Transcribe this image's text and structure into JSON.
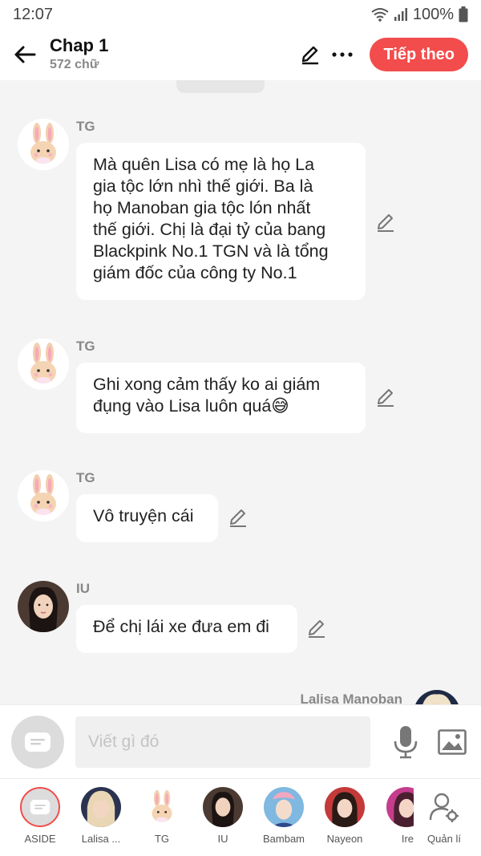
{
  "status": {
    "time": "12:07",
    "battery": "100%"
  },
  "header": {
    "title": "Chap 1",
    "subtitle": "572 chữ",
    "next_label": "Tiếp theo"
  },
  "messages": [
    {
      "sender": "TG",
      "lines": [
        "Mà quên Lisa có mẹ là họ La",
        "gia tộc lớn nhì thế giới. Ba là",
        "họ Manoban gia tộc lón nhất",
        "thế giới. Chị là đại tỷ của bang",
        "Blackpink No.1 TGN và là tổng",
        "giám đốc của công ty No.1"
      ]
    },
    {
      "sender": "TG",
      "lines": [
        "Ghi xong cảm thấy ko ai giám",
        "đụng vào Lisa luôn quá😅"
      ]
    },
    {
      "sender": "TG",
      "lines": [
        "Vô truyện cái"
      ]
    },
    {
      "sender": "IU",
      "lines": [
        "Để chị lái xe đưa em đi"
      ]
    },
    {
      "sender": "Lalisa Manoban",
      "lines": []
    }
  ],
  "input": {
    "placeholder": "Viết gì đó"
  },
  "characters": [
    {
      "label": "ASIDE"
    },
    {
      "label": "Lalisa ..."
    },
    {
      "label": "TG"
    },
    {
      "label": "IU"
    },
    {
      "label": "Bambam"
    },
    {
      "label": "Nayeon"
    },
    {
      "label": "Ire"
    },
    {
      "label": "Quản lí"
    }
  ],
  "colors": {
    "accent": "#f24c4c",
    "background": "#f4f4f4"
  }
}
